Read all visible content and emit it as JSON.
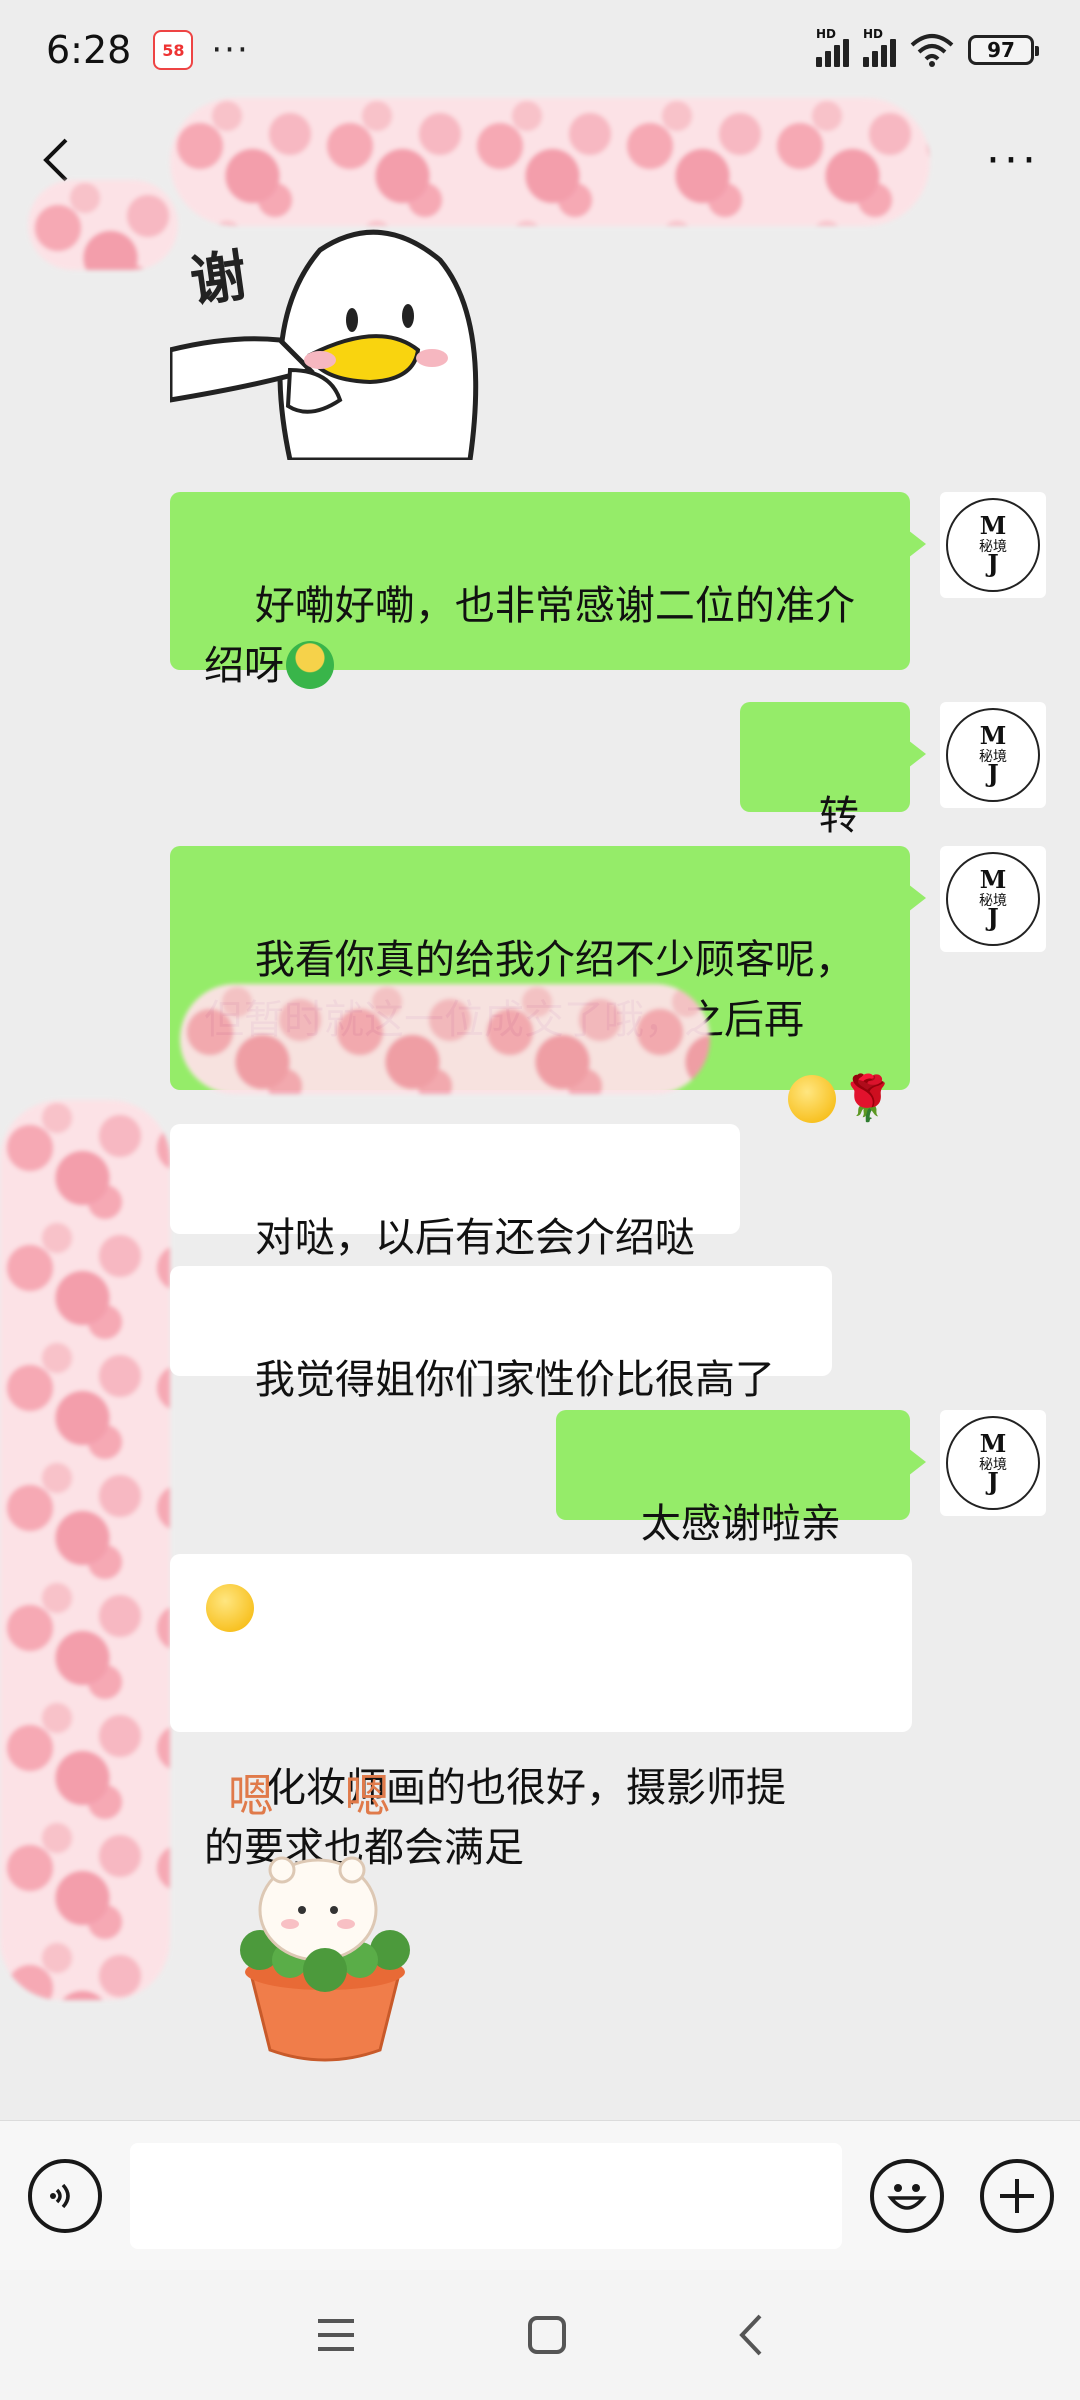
{
  "status_bar": {
    "time": "6:28",
    "app_badge": "58",
    "more": "···",
    "signal1_label": "HD",
    "signal2_label": "HD",
    "battery": "97"
  },
  "title_bar": {
    "back_icon": "chevron-left-icon",
    "more": "···"
  },
  "messages": [
    {
      "side": "me",
      "text": "好嘞好嘞，也非常感谢二位的准介\n绍呀",
      "emoji": "hug-emoji"
    },
    {
      "side": "me",
      "text": "转",
      "emoji": "laugh-cry-emoji"
    },
    {
      "side": "me",
      "text": "我看你真的给我介绍不少顾客呢，\n但暂时就这一位成交了哦，之后再",
      "emoji": "smile-emoji rose-emoji"
    },
    {
      "side": "them",
      "text": "对哒，以后有还会介绍哒"
    },
    {
      "side": "them",
      "text": "我觉得姐你们家性价比很高了"
    },
    {
      "side": "me",
      "text": "太感谢啦亲",
      "emoji": "heart-emoji"
    },
    {
      "side": "them",
      "text": "化妆师画的也很好，摄影师提\n的要求也都会满足",
      "emoji": "grin-emoji"
    }
  ],
  "stickers": {
    "duck_text": "谢",
    "bear_text": "嗯 嗯"
  },
  "avatar": {
    "m": "M",
    "cn": "秘境",
    "j": "J"
  },
  "input_bar": {
    "value": "",
    "voice_icon": "voice-icon",
    "emoji_icon": "emoji-icon",
    "plus_icon": "plus-icon"
  },
  "nav_bar": {
    "menu_icon": "menu-icon",
    "home_icon": "home-icon",
    "back_icon": "back-icon"
  },
  "colors": {
    "my_bubble": "#95ec69",
    "their_bubble": "#ffffff",
    "background": "#ededed"
  }
}
